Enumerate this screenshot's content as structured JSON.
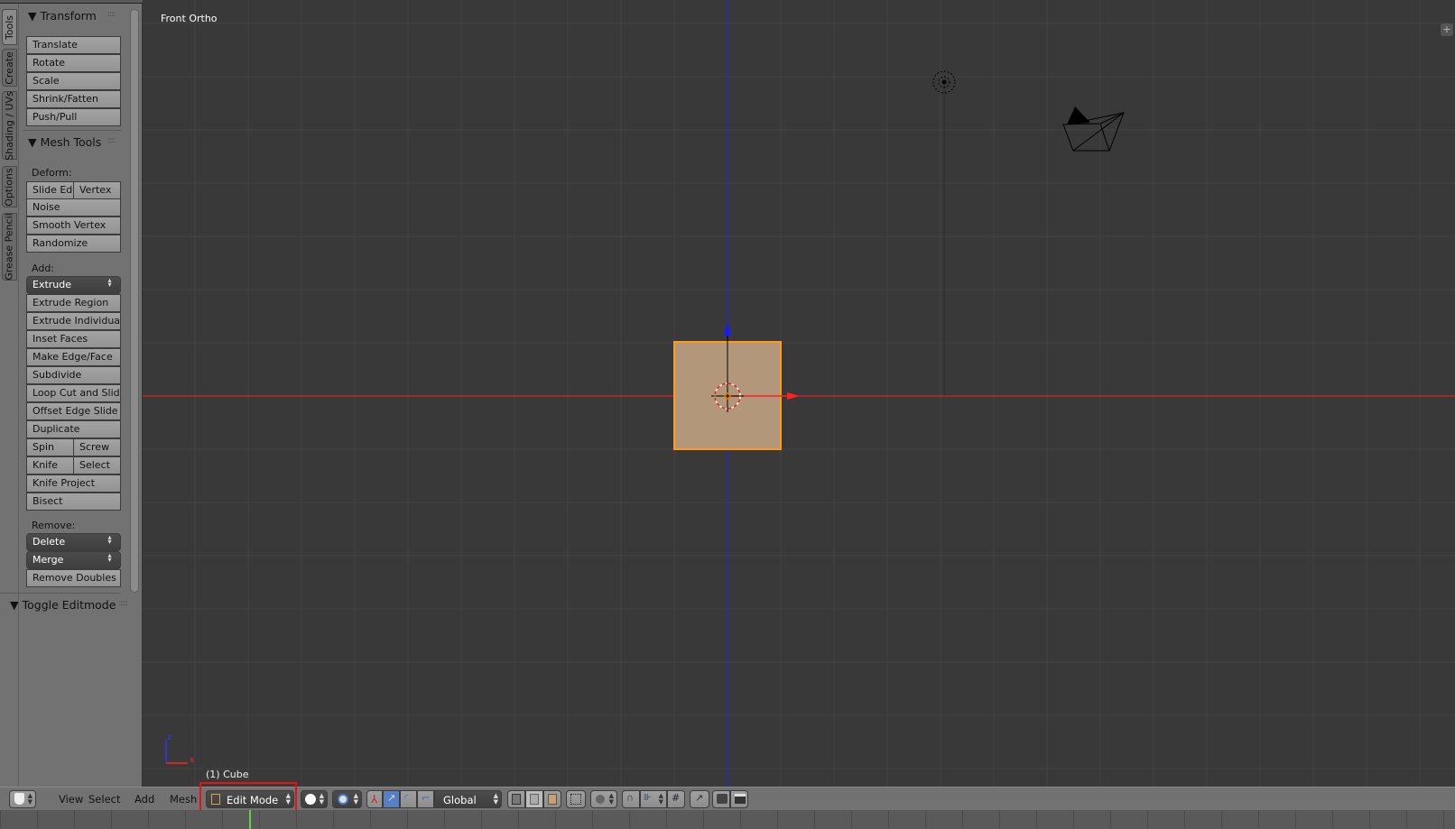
{
  "viewport": {
    "view_name": "Front Ortho",
    "object_info": "(1) Cube",
    "axis_x_label": "x",
    "axis_z_label": "z",
    "colors": {
      "x_axis": "#ff2020",
      "z_axis": "#2020ff",
      "cube_face": "#b3977b",
      "cube_edge": "#ff9a1a"
    }
  },
  "tabs": [
    "Tools",
    "Create",
    "Shading / UVs",
    "Options",
    "Grease Pencil"
  ],
  "panel": {
    "transform_title": "Transform",
    "mesh_tools_title": "Mesh Tools",
    "toggle_editmode_title": "Toggle Editmode",
    "rows": [
      {
        "t": "btn",
        "labels": [
          "Translate"
        ]
      },
      {
        "t": "btn",
        "labels": [
          "Rotate"
        ]
      },
      {
        "t": "btn",
        "labels": [
          "Scale"
        ]
      },
      {
        "t": "btn",
        "labels": [
          "Shrink/Fatten"
        ]
      },
      {
        "t": "btn",
        "labels": [
          "Push/Pull"
        ]
      },
      {
        "t": "label",
        "labels": [
          "Deform:"
        ]
      },
      {
        "t": "split",
        "labels": [
          "Slide Ed",
          "Vertex"
        ]
      },
      {
        "t": "btn",
        "labels": [
          "Noise"
        ]
      },
      {
        "t": "btn",
        "labels": [
          "Smooth Vertex"
        ]
      },
      {
        "t": "btn",
        "labels": [
          "Randomize"
        ]
      },
      {
        "t": "label",
        "labels": [
          "Add:"
        ]
      },
      {
        "t": "dd",
        "labels": [
          "Extrude"
        ]
      },
      {
        "t": "btn",
        "labels": [
          "Extrude Region"
        ]
      },
      {
        "t": "btn",
        "labels": [
          "Extrude Individual"
        ]
      },
      {
        "t": "btn",
        "labels": [
          "Inset Faces"
        ]
      },
      {
        "t": "btn",
        "labels": [
          "Make Edge/Face"
        ]
      },
      {
        "t": "btn",
        "labels": [
          "Subdivide"
        ]
      },
      {
        "t": "btn",
        "labels": [
          "Loop Cut and Slide"
        ]
      },
      {
        "t": "btn",
        "labels": [
          "Offset Edge Slide"
        ]
      },
      {
        "t": "btn",
        "labels": [
          "Duplicate"
        ]
      },
      {
        "t": "split",
        "labels": [
          "Spin",
          "Screw"
        ]
      },
      {
        "t": "split",
        "labels": [
          "Knife",
          "Select"
        ]
      },
      {
        "t": "btn",
        "labels": [
          "Knife Project"
        ]
      },
      {
        "t": "btn",
        "labels": [
          "Bisect"
        ]
      },
      {
        "t": "label",
        "labels": [
          "Remove:"
        ]
      },
      {
        "t": "dd",
        "labels": [
          "Delete"
        ]
      },
      {
        "t": "dd",
        "labels": [
          "Merge"
        ]
      },
      {
        "t": "btn",
        "labels": [
          "Remove Doubles"
        ]
      }
    ]
  },
  "header": {
    "menus": [
      "View",
      "Select",
      "Add",
      "Mesh"
    ],
    "mode": "Edit Mode",
    "orientation": "Global",
    "highlight_color": "#e81010"
  }
}
